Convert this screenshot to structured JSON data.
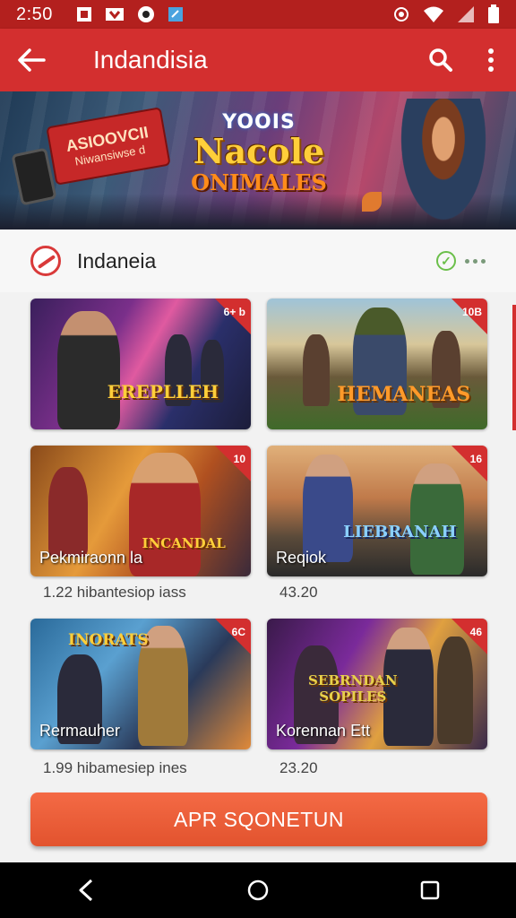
{
  "status_bar": {
    "time": "2:50",
    "icons_left": [
      "notification-icon",
      "mail-icon",
      "media-icon",
      "calendar-icon"
    ],
    "icons_right": [
      "gear-icon",
      "wifi-icon",
      "signal-icon",
      "battery-icon"
    ]
  },
  "app_bar": {
    "title": "Indandisia",
    "back_icon": "arrow-left-icon",
    "search_icon": "search-icon",
    "menu_icon": "more-vert-icon",
    "color": "#d32f2f"
  },
  "banner": {
    "sign_line1": "ASIOOVCII",
    "sign_line2": "Niwansiwse d",
    "logo_top": "YOOIS",
    "logo_main": "Nacole",
    "logo_sub": "ONIMALES"
  },
  "section": {
    "title": "Indaneia",
    "verified_icon": "check-circle-icon",
    "more_icon": "more-horiz-icon"
  },
  "cards": [
    {
      "corner": "6+ b",
      "logo": "EREPLLEH",
      "label": "",
      "theme": "purple"
    },
    {
      "corner": "10B",
      "logo": "HEMANEAS",
      "label": "",
      "theme": "green"
    },
    {
      "corner": "10",
      "logo": "",
      "label": "Pekmiraonn la",
      "logo_small": "INCANDAL",
      "theme": "orange"
    },
    {
      "corner": "16",
      "logo": "LIEBRANAH",
      "label": "Reqiok",
      "theme": "city"
    },
    {
      "corner": "6C",
      "logo": "INORATS",
      "label": "Rermauher",
      "theme": "blue"
    },
    {
      "corner": "46",
      "logo": "SEBRNDAN SOPILES",
      "label": "Korennan Ett",
      "theme": "violet"
    }
  ],
  "meta": [
    {
      "text": "1.22 hibantesiop iass",
      "rating": "43.20"
    },
    {
      "text": "1.99 hibamesiep ines",
      "rating": "23.20"
    }
  ],
  "cta_label": "APR SQONETUN",
  "nav": {
    "back": "back-triangle-icon",
    "home": "home-circle-icon",
    "recents": "recents-square-icon"
  }
}
